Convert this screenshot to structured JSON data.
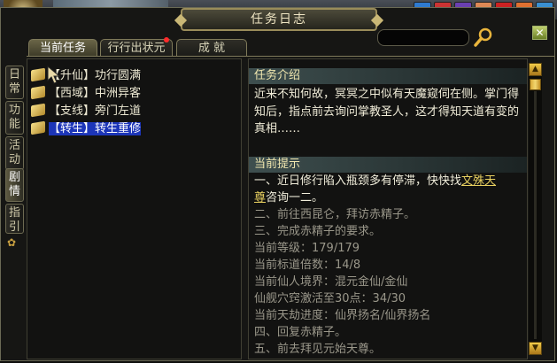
{
  "window": {
    "title": "任务日志",
    "close_label": "✕"
  },
  "search": {
    "value": ""
  },
  "tabs": [
    {
      "label": "当前任务",
      "active": true
    },
    {
      "label": "行行出状元",
      "active": false,
      "has_alert": true
    },
    {
      "label": "成  就",
      "active": false
    }
  ],
  "side_tabs": [
    {
      "label": "日常"
    },
    {
      "label": "功能"
    },
    {
      "label": "活动"
    },
    {
      "label": "剧情",
      "active": true
    },
    {
      "label": "指引"
    }
  ],
  "task_list": [
    {
      "prefix": "【升仙】",
      "name": "功行圆满"
    },
    {
      "prefix": "【西域】",
      "name": "中洲异客"
    },
    {
      "prefix": "【支线】",
      "name": "旁门左道"
    },
    {
      "prefix": "【转生】",
      "name": "转生重修",
      "selected": true
    }
  ],
  "intro": {
    "heading": "任务介绍",
    "text": "近来不知何故，冥冥之中似有天魔窥伺在侧。掌门得知后，指点前去询问掌教圣人，这才得知天道有变的真相……"
  },
  "hint": {
    "heading": "当前提示",
    "step1_a": "一、近日修行陷入瓶颈多有停滞，快快找",
    "step1_link_a": "文殊天",
    "step1_link_b": "尊",
    "step1_b": "咨询一二。",
    "lines": [
      "二、前往西昆仑，拜访赤精子。",
      "三、完成赤精子的要求。",
      "当前等级：179/179",
      "当前标道倍数：14/8",
      "当前仙人境界：混元金仙/金仙",
      "仙舰穴窍激活至30点：34/30",
      "当前天劫进度：仙界扬名/仙界扬名",
      "四、回复赤精子。",
      "五、前去拜见元始天尊。"
    ]
  },
  "colors": {
    "selection": "#1c35b8",
    "link": "#e8d060",
    "heading_bg": "#3e4f4f"
  }
}
